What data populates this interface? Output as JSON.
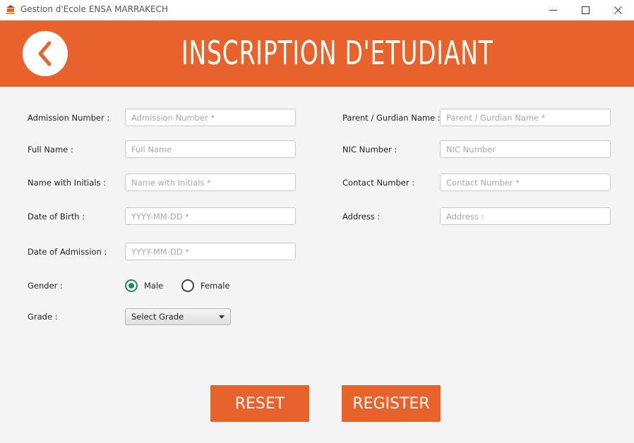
{
  "window": {
    "title": "Gestion d'Ecole ENSA MARRAKECH"
  },
  "header": {
    "title": "INSCRIPTION D'ETUDIANT",
    "back_icon": "chevron-left-icon",
    "color": "#e8632c"
  },
  "form": {
    "left": [
      {
        "label": "Admission Number :",
        "placeholder": "Admission Number *",
        "value": ""
      },
      {
        "label": "Full Name :",
        "placeholder": "Full Name",
        "value": ""
      },
      {
        "label": "Name with Initials :",
        "placeholder": "Name with Initials *",
        "value": ""
      },
      {
        "label": "Date of Birth :",
        "placeholder": "YYYY-MM-DD *",
        "value": ""
      },
      {
        "label": "Date of Admission :",
        "placeholder": "YYYY-MM-DD *",
        "value": ""
      }
    ],
    "right": [
      {
        "label": "Parent / Gurdian Name :",
        "placeholder": "Parent / Gurdian Name *",
        "value": ""
      },
      {
        "label": "NIC Number :",
        "placeholder": "NIC Number",
        "value": ""
      },
      {
        "label": "Contact Number :",
        "placeholder": "Contact Number *",
        "value": ""
      },
      {
        "label": "Address :",
        "placeholder": "Address :",
        "value": ""
      }
    ],
    "gender": {
      "label": "Gender :",
      "options": [
        "Male",
        "Female"
      ],
      "selected": "Male"
    },
    "grade": {
      "label": "Grade :",
      "selected": "Select Grade"
    }
  },
  "actions": {
    "reset_label": "RESET",
    "register_label": "REGISTER"
  },
  "colors": {
    "accent": "#e8632c",
    "radio_selected": "#1f8a5a"
  }
}
